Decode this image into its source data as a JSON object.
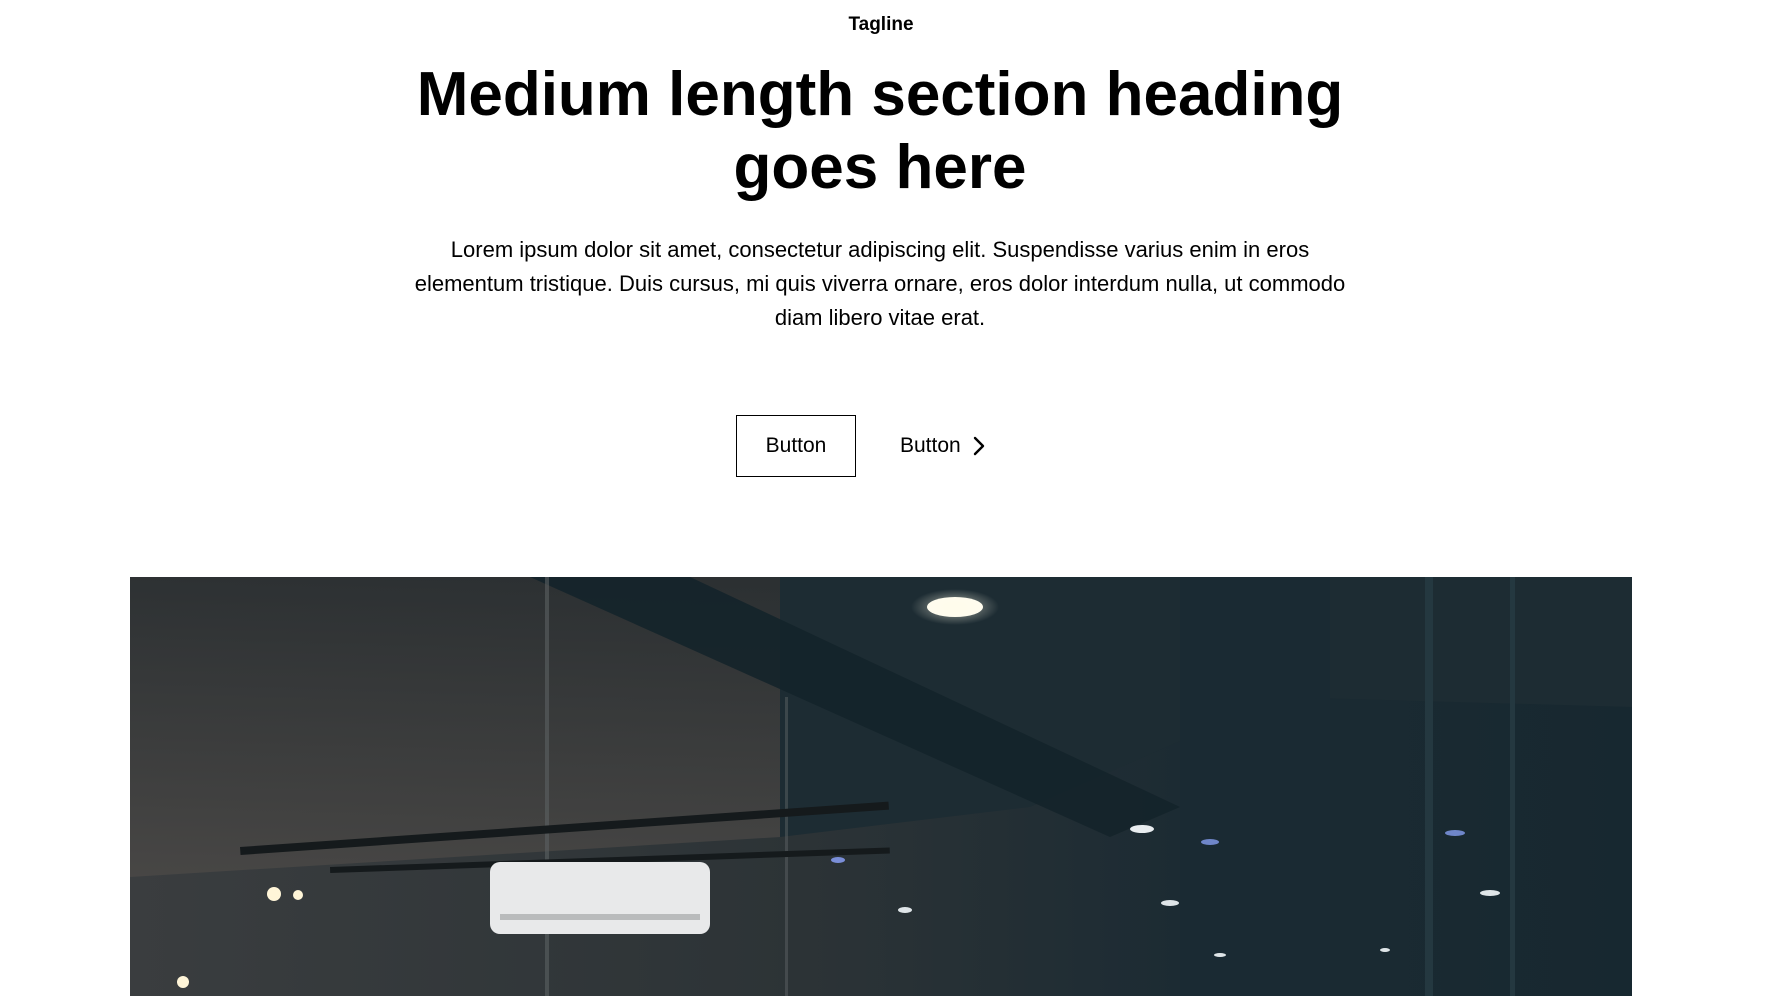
{
  "section": {
    "tagline": "Tagline",
    "heading": "Medium length section heading goes here",
    "body": "Lorem ipsum dolor sit amet, consectetur adipiscing elit. Suspendisse varius enim in eros elementum tristique. Duis cursus, mi quis viverra ornare, eros dolor interdum nulla, ut commodo diam libero vitae erat."
  },
  "actions": {
    "primary_label": "Button",
    "secondary_label": "Button",
    "secondary_icon": "chevron-right-icon"
  },
  "hero_image": {
    "subject": "dark interior ceiling with glass walls, ceiling lights and air conditioner"
  },
  "colors": {
    "text": "#000000",
    "background": "#ffffff",
    "image_dark": "#1a2a33"
  }
}
